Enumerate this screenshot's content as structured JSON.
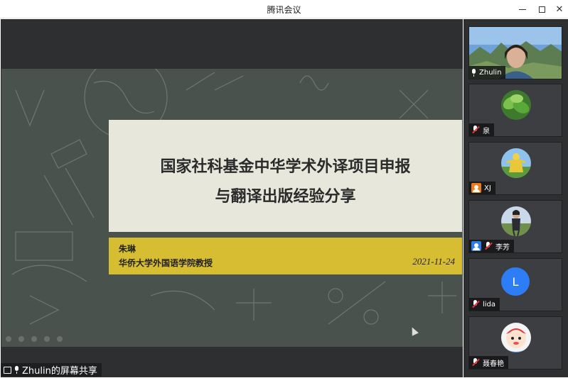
{
  "window": {
    "title": "腾讯会议"
  },
  "slide": {
    "title_line1": "国家社科基金中华学术外译项目申报",
    "title_line2": "与翻译出版经验分享",
    "author": "朱琳",
    "institution": "华侨大学外国语学院教授",
    "date": "2021-11-24"
  },
  "share_label": "Zhulin的屏幕共享",
  "participants": [
    {
      "name": "Zhulin",
      "status_icon": "mic-icon",
      "avatar": "video"
    },
    {
      "name": "泉",
      "status_icon": "mic-muted-icon",
      "avatar": "plant-photo"
    },
    {
      "name": "XJ",
      "status_icon": "person-icon",
      "avatar": "figure-photo"
    },
    {
      "name": "李芳",
      "status_icon": "mic-muted-icon",
      "avatar": "person-photo"
    },
    {
      "name": "lida",
      "status_icon": "mic-muted-icon",
      "avatar_letter": "L"
    },
    {
      "name": "聂春艳",
      "status_icon": "mic-muted-icon",
      "avatar": "cartoon-photo"
    }
  ],
  "colors": {
    "accent_blue": "#2d7df6",
    "person_icon_orange": "#f07a1a",
    "person_icon_blue": "#2f7cf0",
    "muted_red": "#e03838",
    "slide_title_bg": "#e7e7dc",
    "slide_author_bg": "#d7bd32"
  }
}
